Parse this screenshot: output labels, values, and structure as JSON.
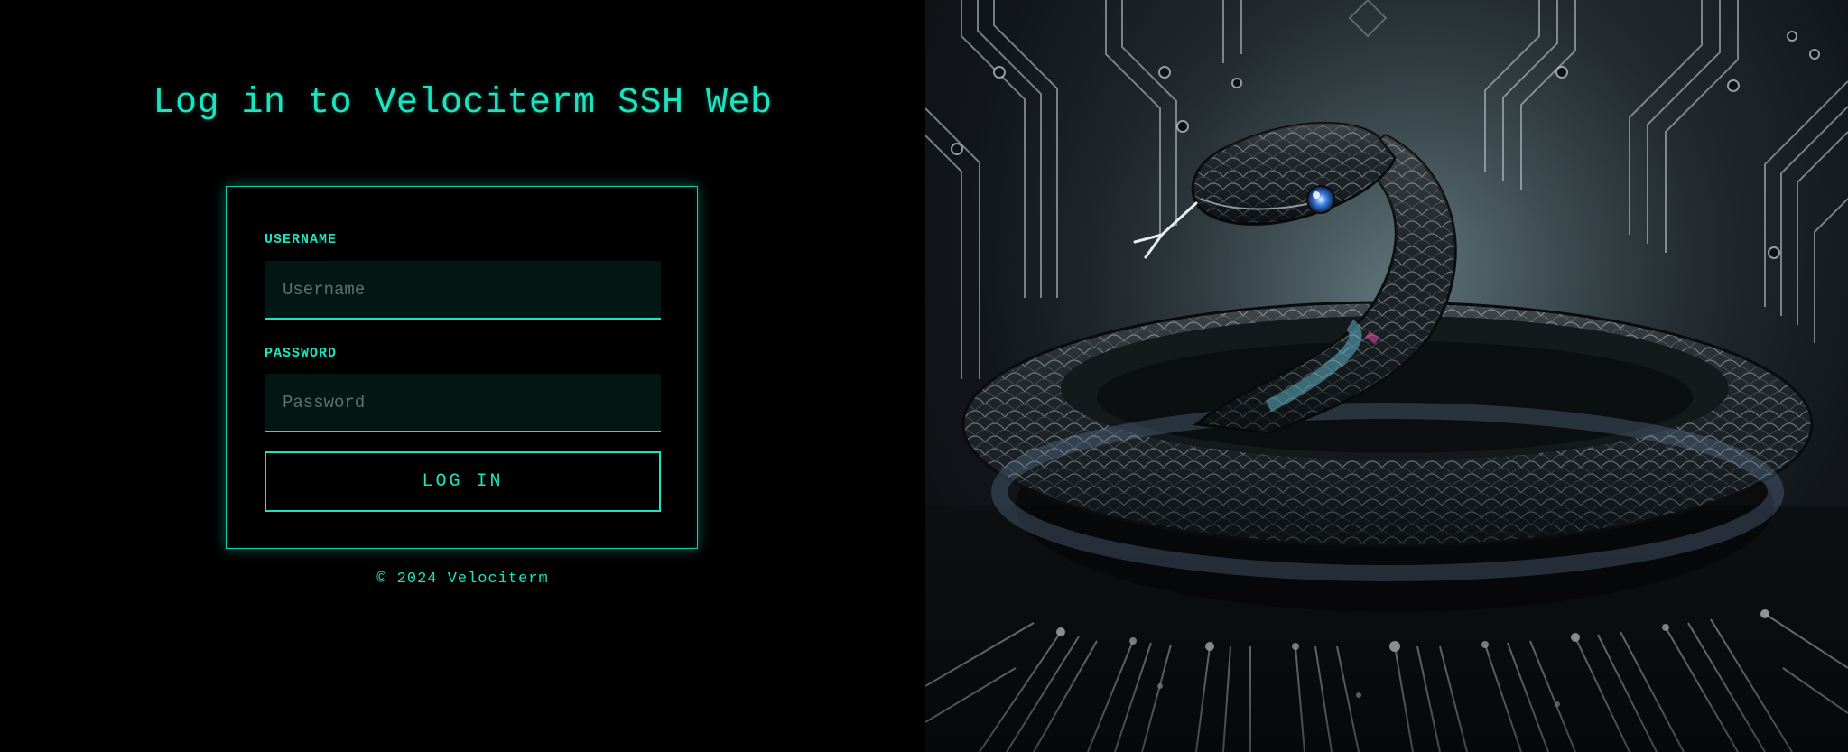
{
  "login": {
    "title": "Log in to Velociterm SSH Web",
    "username_label": "USERNAME",
    "username_placeholder": "Username",
    "password_label": "PASSWORD",
    "password_placeholder": "Password",
    "submit_label": "LOG IN"
  },
  "footer": {
    "copyright": "© 2024 Velociterm"
  },
  "illustration": {
    "subject": "snake-on-circuit-board-image"
  },
  "colors": {
    "accent": "#1ee3bf",
    "background": "#000000",
    "input_background": "#021614",
    "placeholder": "#5f6e6b"
  }
}
